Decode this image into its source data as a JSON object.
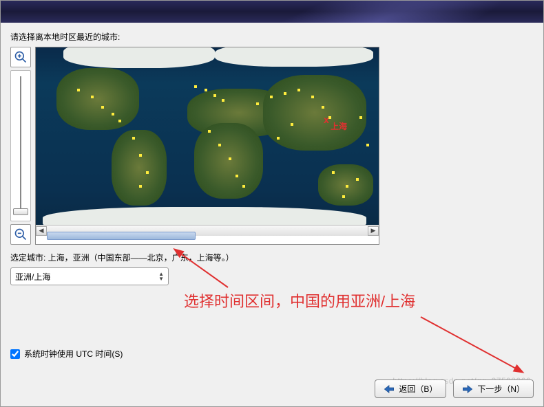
{
  "header": {},
  "prompt": "请选择离本地时区最近的城市:",
  "zoom": {
    "in_name": "zoom-in-icon",
    "out_name": "zoom-out-icon"
  },
  "map": {
    "marker_label": "上海",
    "marker_symbol": "x"
  },
  "selected_city": {
    "label": "选定城市: 上海，亚洲（中国东部——北京，广东，上海等。）"
  },
  "timezone_select": {
    "value": "亚洲/上海"
  },
  "annotation_text": "选择时间区间，中国的用亚洲/上海",
  "utc_checkbox": {
    "label": "系统时钟使用 UTC 时间(S)",
    "checked": true
  },
  "buttons": {
    "back": "返回（B）",
    "next": "下一步（N）"
  },
  "watermark": "https://blog.csdn.net/qq_37598066",
  "colors": {
    "accent_red": "#e03030",
    "city_dot": "#ffec3d"
  }
}
